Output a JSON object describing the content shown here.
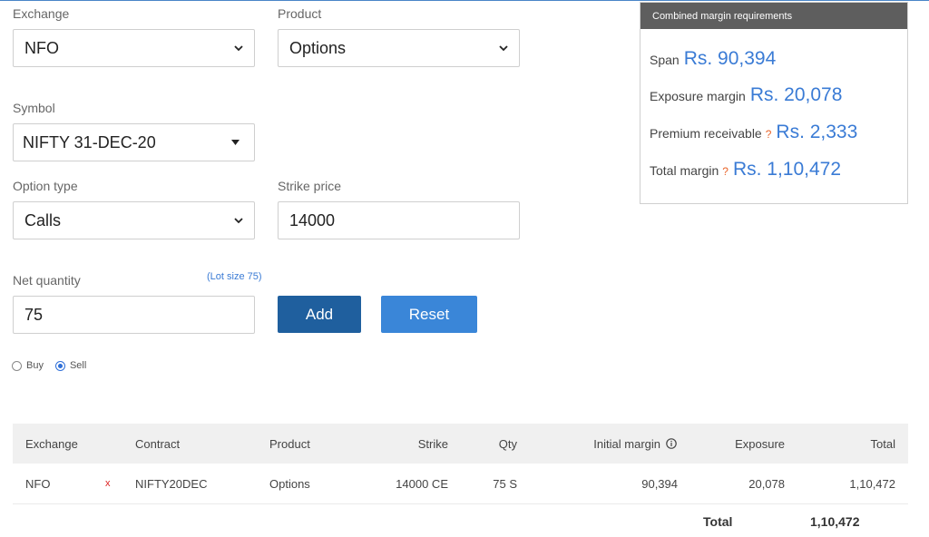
{
  "form": {
    "exchange_label": "Exchange",
    "exchange_value": "NFO",
    "product_label": "Product",
    "product_value": "Options",
    "symbol_label": "Symbol",
    "symbol_value": "NIFTY 31-DEC-20",
    "option_type_label": "Option type",
    "option_type_value": "Calls",
    "strike_label": "Strike price",
    "strike_value": "14000",
    "qty_label": "Net quantity",
    "lot_size": "(Lot size 75)",
    "qty_value": "75",
    "add_label": "Add",
    "reset_label": "Reset",
    "buy_label": "Buy",
    "sell_label": "Sell",
    "selected_side": "Sell"
  },
  "margin_panel": {
    "title": "Combined margin requirements",
    "span_label": "Span",
    "span_value": "Rs. 90,394",
    "exposure_label": "Exposure margin",
    "exposure_value": "Rs. 20,078",
    "premium_label": "Premium receivable",
    "premium_value": "Rs. 2,333",
    "total_label": "Total margin",
    "total_value": "Rs. 1,10,472",
    "help_mark": "?"
  },
  "table": {
    "headers": {
      "exchange": "Exchange",
      "contract": "Contract",
      "product": "Product",
      "strike": "Strike",
      "qty": "Qty",
      "initial_margin": "Initial margin",
      "exposure": "Exposure",
      "total": "Total"
    },
    "rows": [
      {
        "exchange": "NFO",
        "remove": "x",
        "contract": "NIFTY20DEC",
        "product": "Options",
        "strike": "14000 CE",
        "qty": "75 S",
        "initial_margin": "90,394",
        "exposure": "20,078",
        "total": "1,10,472"
      }
    ],
    "footer_label": "Total",
    "footer_value": "1,10,472"
  },
  "colors": {
    "accent": "#3a7bd5",
    "add_button": "#1f5f9e",
    "reset_button": "#3a86d8",
    "panel_header": "#5e5e5e",
    "help_mark": "#e9652b"
  }
}
